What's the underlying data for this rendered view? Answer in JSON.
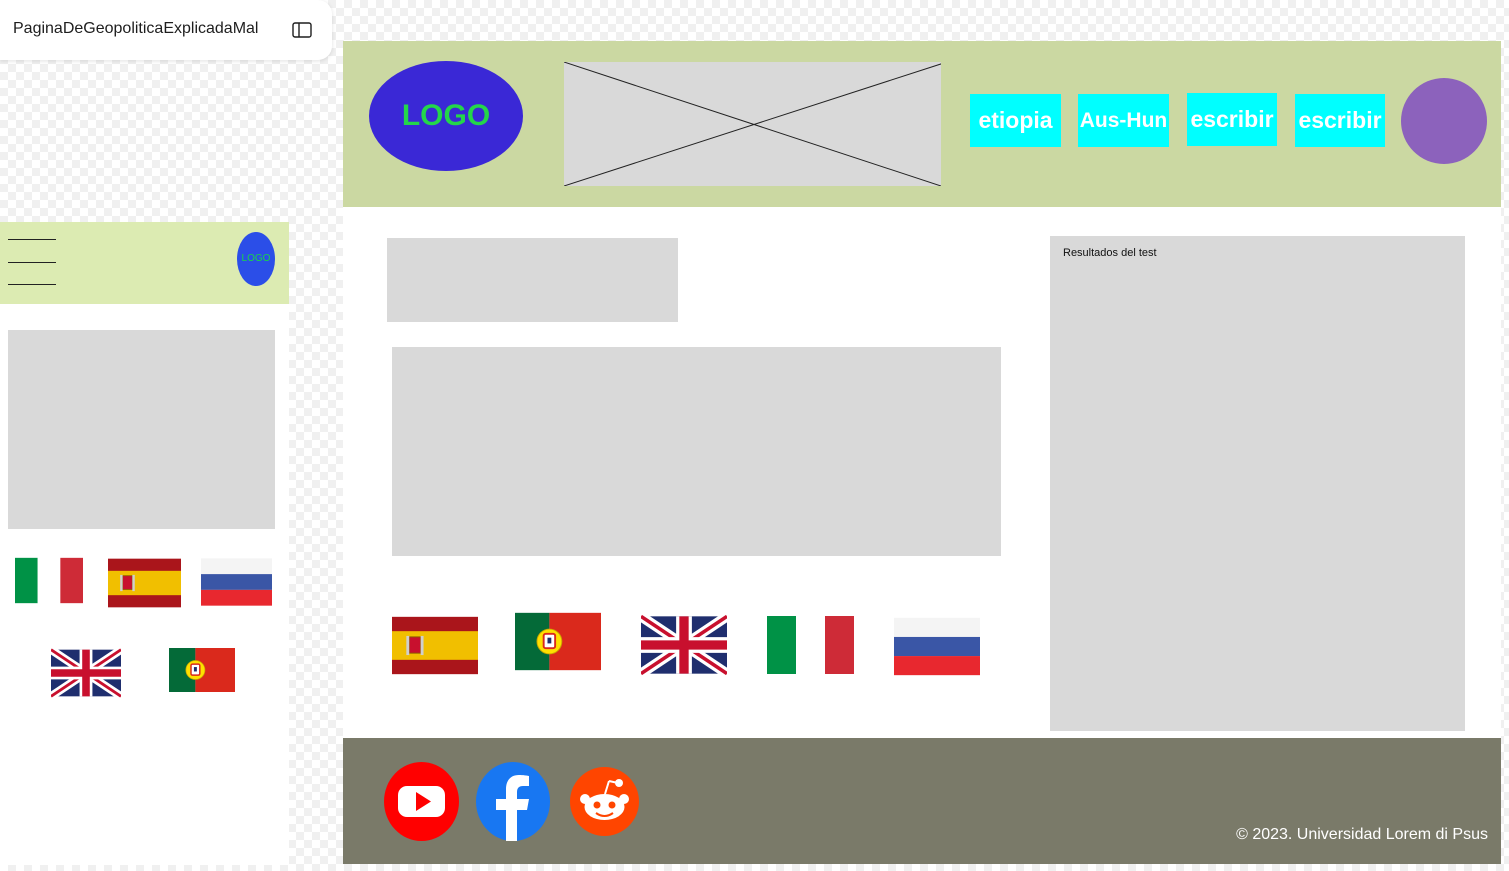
{
  "file_tab": {
    "name": "PaginaDeGeopoliticaExplicadaMal",
    "icon": "panel-toggle-icon"
  },
  "mobile": {
    "logo_text": "LOGO",
    "menu_icon": "hamburger-menu-icon",
    "flags": [
      "italy",
      "spain",
      "russia",
      "united-kingdom",
      "portugal"
    ]
  },
  "desktop": {
    "logo_text": "LOGO",
    "nav": [
      "etiopia",
      "Aus-Hun",
      "escribir",
      "escribir"
    ],
    "results_label": "Resultados del test",
    "flags": [
      "spain",
      "portugal",
      "united-kingdom",
      "italy",
      "russia"
    ],
    "social": [
      "youtube-icon",
      "facebook-icon",
      "reddit-icon"
    ],
    "copyright": "© 2023. Universidad Lorem di Psus"
  },
  "colors": {
    "header": "#cbd8a2",
    "mobile_header": "#dcebb2",
    "nav_button": "#00ffff",
    "footer": "#7a7a69",
    "avatar": "#8c62bc",
    "logo_desktop": "#3a28d6",
    "logo_mobile": "#2b4ee8"
  }
}
